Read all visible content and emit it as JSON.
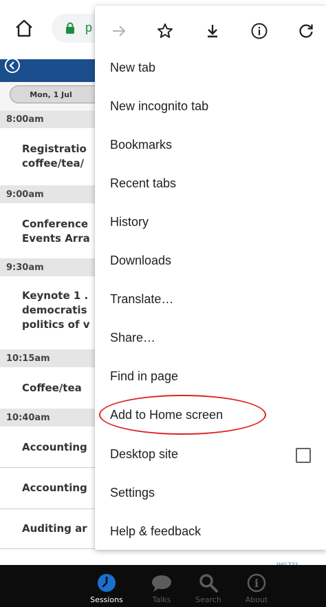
{
  "browser": {
    "url_visible": "p",
    "icons": [
      "home-icon",
      "lock-icon"
    ]
  },
  "menu": {
    "top_icons": [
      "forward-arrow-icon",
      "star-bookmark-icon",
      "download-icon",
      "info-icon",
      "reload-icon"
    ],
    "items": [
      {
        "label": "New tab"
      },
      {
        "label": "New incognito tab"
      },
      {
        "label": "Bookmarks"
      },
      {
        "label": "Recent tabs"
      },
      {
        "label": "History"
      },
      {
        "label": "Downloads"
      },
      {
        "label": "Translate…"
      },
      {
        "label": "Share…"
      },
      {
        "label": "Find in page"
      },
      {
        "label": "Add to Home screen"
      },
      {
        "label": "Desktop site",
        "checkbox": false
      },
      {
        "label": "Settings"
      },
      {
        "label": "Help & feedback"
      }
    ],
    "highlighted_item": "Add to Home screen",
    "annotation_color": "#e02020"
  },
  "app": {
    "header_color": "#1a4e8c",
    "date_tab": "Mon, 1 Jul",
    "times": [
      "8:00am",
      "9:00am",
      "9:30am",
      "10:15am",
      "10:40am"
    ],
    "sessions": [
      {
        "lines": [
          "Registratio",
          "coffee/tea/"
        ]
      },
      {
        "lines": [
          "Conference",
          "Events Arra"
        ]
      },
      {
        "lines": [
          "Keynote 1 .",
          "democratis",
          "politics of v"
        ]
      },
      {
        "lines": [
          "Coffee/tea"
        ]
      },
      {
        "lines": [
          "Accounting"
        ]
      },
      {
        "lines": [
          "Accounting"
        ]
      },
      {
        "lines": [
          "Auditing ar"
        ]
      }
    ],
    "peek_code": "WG7??"
  },
  "tabbar": {
    "tabs": [
      {
        "label": "Sessions",
        "icon": "clock-icon",
        "active": true
      },
      {
        "label": "Talks",
        "icon": "speech-bubble-icon",
        "active": false
      },
      {
        "label": "Search",
        "icon": "search-icon",
        "active": false
      },
      {
        "label": "About",
        "icon": "info-icon",
        "active": false
      }
    ],
    "active_color": "#1a6fd1"
  }
}
